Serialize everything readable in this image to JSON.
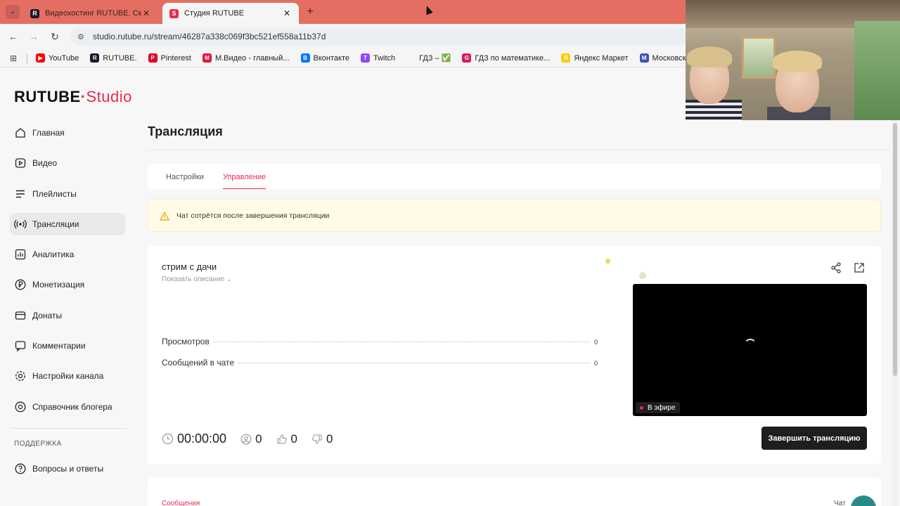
{
  "browser": {
    "tabs": [
      {
        "title": "Видеохостинг RUTUBE. Смотри",
        "active": false,
        "favicon": "R"
      },
      {
        "title": "Студия RUTUBE",
        "active": true,
        "favicon": "S"
      }
    ],
    "url": "studio.rutube.ru/stream/46287a338c069f3bc521ef558a11b37d",
    "bookmarks": [
      {
        "label": "YouTube",
        "icon": "youtube-icon",
        "color": "#ff0000",
        "glyph": "▶"
      },
      {
        "label": "RUTUBE.",
        "icon": "rutube-icon",
        "color": "#1a1a2e",
        "glyph": "R"
      },
      {
        "label": "Pinterest",
        "icon": "pinterest-icon",
        "color": "#e60023",
        "glyph": "P"
      },
      {
        "label": "М.Видео - главный...",
        "icon": "mvideo-icon",
        "color": "#e31235",
        "glyph": "М"
      },
      {
        "label": "Вконтакте",
        "icon": "vk-icon",
        "color": "#0077ff",
        "glyph": "В"
      },
      {
        "label": "Twitch",
        "icon": "twitch-icon",
        "color": "#9146ff",
        "glyph": "T"
      },
      {
        "label": "ГДЗ – ✅",
        "icon": "gdz-icon",
        "color": "#f5f5f5",
        "glyph": ""
      },
      {
        "label": "ГДЗ по математике...",
        "icon": "gdz-math-icon",
        "color": "#d81b60",
        "glyph": "G"
      },
      {
        "label": "Яндекс Маркет",
        "icon": "yandex-market-icon",
        "color": "#ffcc00",
        "glyph": "Я"
      },
      {
        "label": "Московская электр...",
        "icon": "mesh-icon",
        "color": "#3f51b5",
        "glyph": "M"
      }
    ]
  },
  "app": {
    "logo_main": "RUTUBE",
    "logo_dot": "·",
    "logo_studio": "Studio",
    "nav": [
      {
        "label": "Главная",
        "icon": "home-icon",
        "active": false
      },
      {
        "label": "Видео",
        "icon": "video-icon",
        "active": false
      },
      {
        "label": "Плейлисты",
        "icon": "playlist-icon",
        "active": false
      },
      {
        "label": "Трансляции",
        "icon": "broadcast-icon",
        "active": true
      },
      {
        "label": "Аналитика",
        "icon": "analytics-icon",
        "active": false
      },
      {
        "label": "Монетизация",
        "icon": "monetization-icon",
        "active": false
      },
      {
        "label": "Донаты",
        "icon": "donate-icon",
        "active": false
      },
      {
        "label": "Комментарии",
        "icon": "comments-icon",
        "active": false
      },
      {
        "label": "Настройки канала",
        "icon": "settings-icon",
        "active": false
      },
      {
        "label": "Справочник блогера",
        "icon": "help-icon",
        "active": false
      }
    ],
    "support_section": "ПОДДЕРЖКА",
    "support_items": [
      {
        "label": "Вопросы и ответы",
        "icon": "faq-icon"
      }
    ],
    "page_title": "Трансляция",
    "page_tabs": [
      {
        "label": "Настройки",
        "active": false
      },
      {
        "label": "Управление",
        "active": true
      }
    ],
    "warning_text": "Чат сотрётся после завершения трансляции",
    "stream": {
      "title": "стрим с дачи",
      "show_description": "Показать описание ⌄",
      "stats": [
        {
          "label": "Просмотров",
          "value": "0"
        },
        {
          "label": "Сообщений в чате",
          "value": "0"
        }
      ],
      "duration": "00:00:00",
      "viewers": "0",
      "likes": "0",
      "dislikes": "0",
      "live_badge": "В эфире",
      "end_button": "Завершить трансляцию"
    },
    "messages_label": "Сообщения",
    "chat_label": "Чат"
  },
  "colors": {
    "accent": "#e8294e",
    "tabstrip": "#e56e63",
    "warning_bg": "#fffbe6"
  }
}
